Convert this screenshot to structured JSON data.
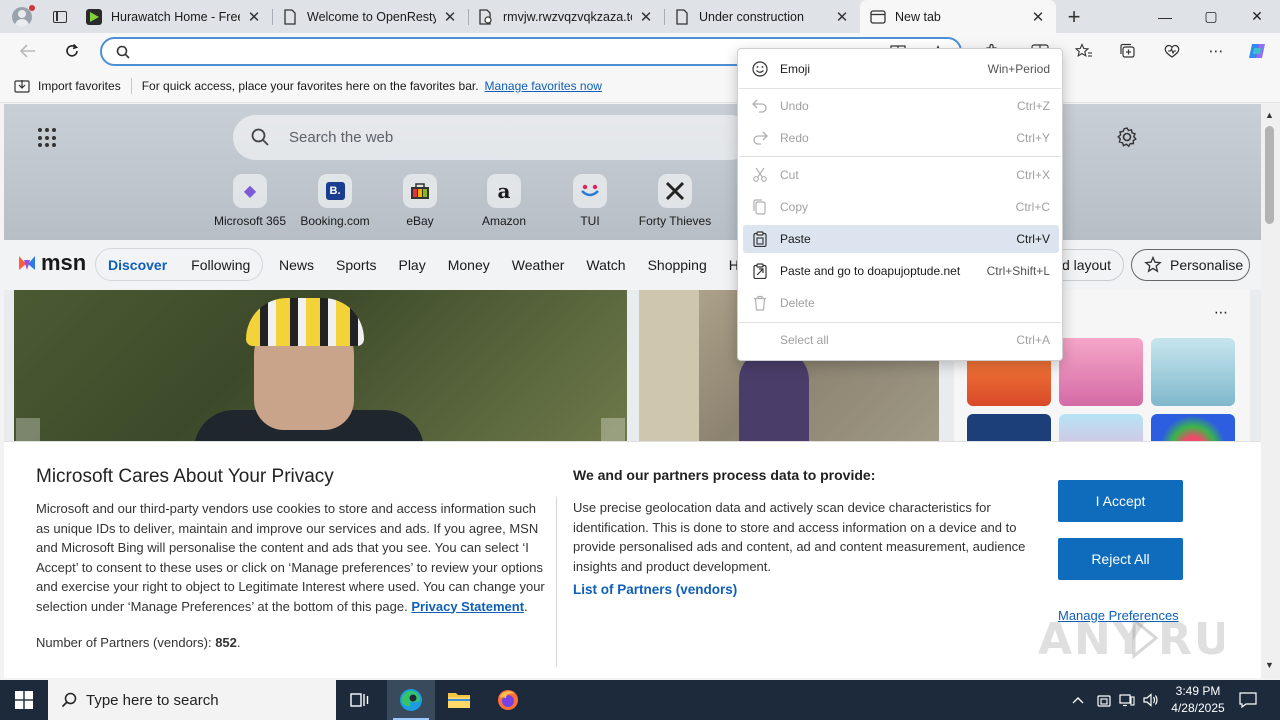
{
  "tabs": [
    {
      "title": "Hurawatch Home - Free",
      "favicon": "hurawatch-icon"
    },
    {
      "title": "Welcome to OpenResty!",
      "favicon": "page-icon"
    },
    {
      "title": "rmvjw.rwzvqzvqkzaza.to",
      "favicon": "page-broken-icon"
    },
    {
      "title": "Under construction",
      "favicon": "page-icon"
    },
    {
      "title": "New tab",
      "favicon": "newtab-icon",
      "active": true
    }
  ],
  "window_controls": {
    "minimize": "—",
    "maximize": "▢",
    "close": "✕"
  },
  "address": {
    "value": "",
    "placeholder": ""
  },
  "favorites_bar": {
    "import_label": "Import favorites",
    "hint": "For quick access, place your favorites here on the favorites bar.",
    "manage_link": "Manage favorites now"
  },
  "newtab": {
    "search_placeholder": "Search the web",
    "tiles": [
      {
        "label": "Microsoft 365",
        "icon": "m365-icon",
        "glyph": "◆",
        "color": "#7b5cd6"
      },
      {
        "label": "Booking.com",
        "icon": "booking-icon",
        "glyph": "B.",
        "color": "#1a3d8f"
      },
      {
        "label": "eBay",
        "icon": "ebay-icon",
        "glyph": "▦",
        "color": "#e53238"
      },
      {
        "label": "Amazon",
        "icon": "amazon-icon",
        "glyph": "a",
        "color": "#111111"
      },
      {
        "label": "TUI",
        "icon": "tui-icon",
        "glyph": "◡",
        "color": "#2a7bd3"
      },
      {
        "label": "Forty Thieves",
        "icon": "forty-thieves-icon",
        "glyph": "✕",
        "color": "#222222"
      }
    ],
    "msn_logo": "msn",
    "feed_tabs": {
      "discover": "Discover",
      "following": "Following"
    },
    "nav": [
      "News",
      "Sports",
      "Play",
      "Money",
      "Weather",
      "Watch",
      "Shopping",
      "H"
    ],
    "layout_button": "d layout",
    "personalise_button": "Personalise"
  },
  "context_menu": {
    "items": [
      {
        "label": "Emoji",
        "shortcut": "Win+Period",
        "icon": "emoji-icon",
        "enabled": true
      },
      {
        "label": "Undo",
        "shortcut": "Ctrl+Z",
        "icon": "undo-icon",
        "enabled": false
      },
      {
        "label": "Redo",
        "shortcut": "Ctrl+Y",
        "icon": "redo-icon",
        "enabled": false
      },
      {
        "label": "Cut",
        "shortcut": "Ctrl+X",
        "icon": "cut-icon",
        "enabled": false
      },
      {
        "label": "Copy",
        "shortcut": "Ctrl+C",
        "icon": "copy-icon",
        "enabled": false
      },
      {
        "label": "Paste",
        "shortcut": "Ctrl+V",
        "icon": "paste-icon",
        "enabled": true,
        "highlighted": true
      },
      {
        "label": "Paste and go to doapujoptude.net",
        "shortcut": "Ctrl+Shift+L",
        "icon": "paste-go-icon",
        "enabled": true
      },
      {
        "label": "Delete",
        "shortcut": "",
        "icon": "delete-icon",
        "enabled": false
      },
      {
        "label": "Select all",
        "shortcut": "Ctrl+A",
        "icon": "",
        "enabled": false
      }
    ]
  },
  "privacy": {
    "title": "Microsoft Cares About Your Privacy",
    "body": "Microsoft and our third-party vendors use cookies to store and access information such as unique IDs to deliver, maintain and improve our services and ads. If you agree, MSN and Microsoft Bing will personalise the content and ads that you see. You can select ‘I Accept’ to consent to these uses or click on ‘Manage preferences’ to review your options and exercise your right to object to Legitimate Interest where used.  You can change your selection under ‘Manage Preferences’ at the bottom of this page.",
    "privacy_link": "Privacy Statement",
    "partners_count_label": "Number of Partners (vendors):",
    "partners_count": "852",
    "right_title": "We and our partners process data to provide:",
    "right_body": "Use precise geolocation data and actively scan device characteristics for identification. This is done to store and access information on a device and to provide personalised ads and content, ad and content measurement, audience insights and product development.",
    "partners_link": "List of Partners (vendors)",
    "accept": "I Accept",
    "reject": "Reject All",
    "manage": "Manage Preferences",
    "watermark": "ANY.RUN"
  },
  "taskbar": {
    "search_placeholder": "Type here to search",
    "time": "3:49 PM",
    "date": "4/28/2025"
  },
  "colors": {
    "accent": "#0f6cbd",
    "link": "#0f5fb7",
    "taskbar": "#1c2a3b"
  }
}
